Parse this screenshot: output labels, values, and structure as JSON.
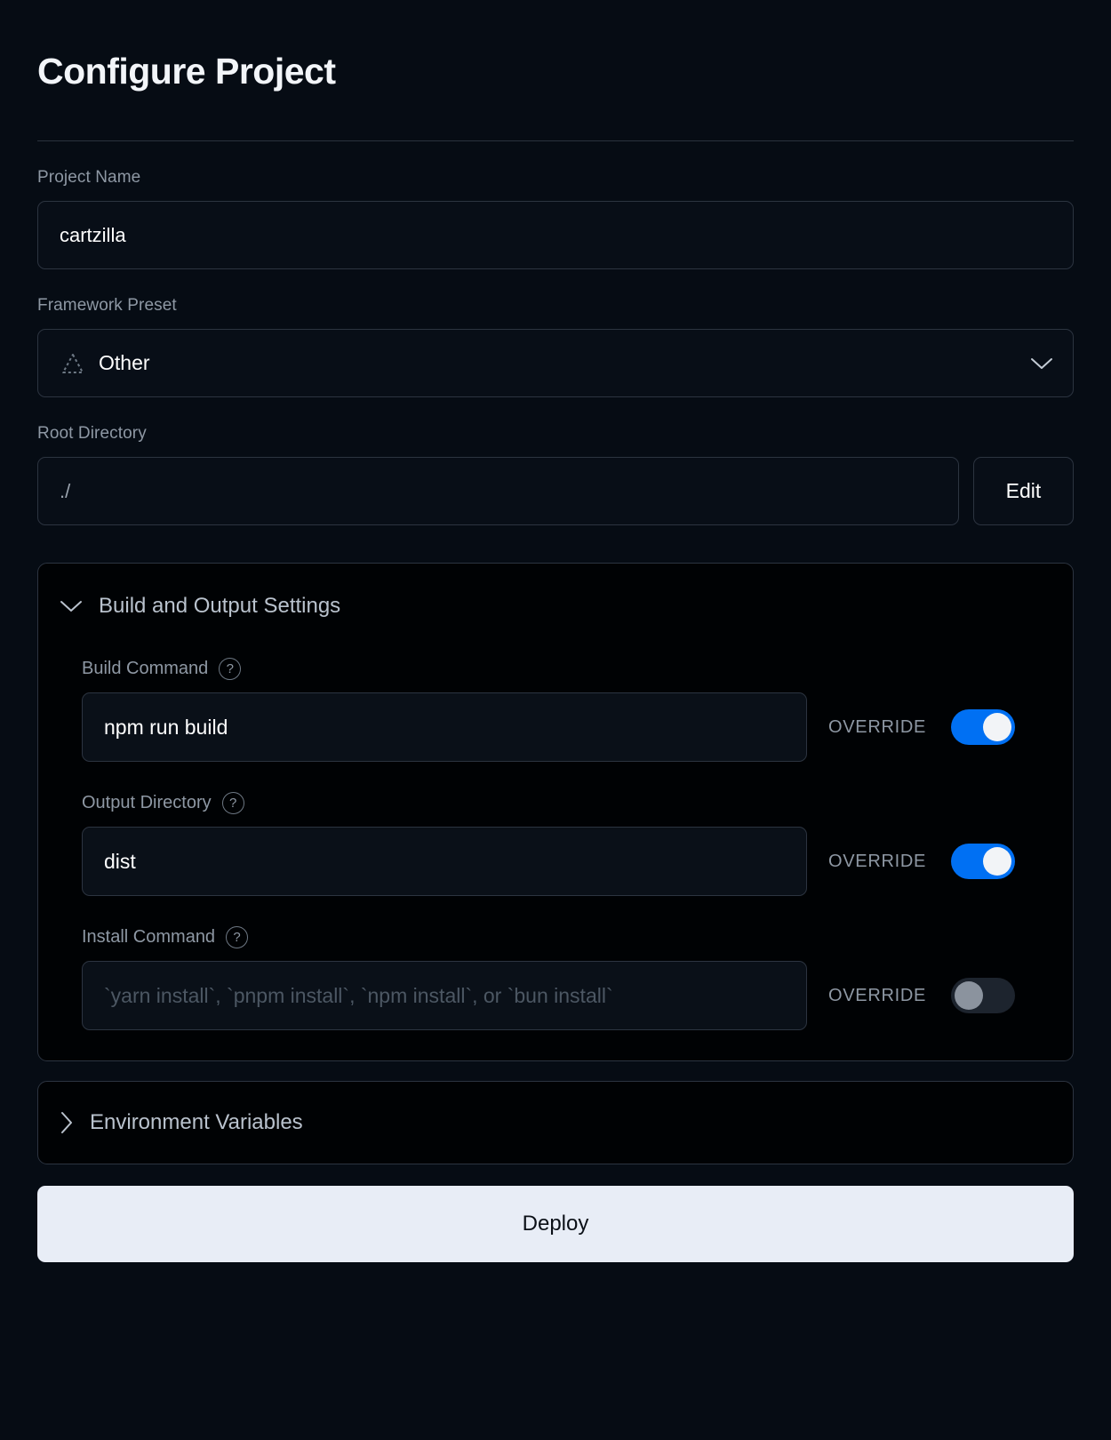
{
  "header": {
    "title": "Configure Project"
  },
  "project_name": {
    "label": "Project Name",
    "value": "cartzilla"
  },
  "framework_preset": {
    "label": "Framework Preset",
    "value": "Other",
    "icon": "dashed-triangle-icon",
    "chevron": "chevron-down-icon"
  },
  "root_directory": {
    "label": "Root Directory",
    "value": "./",
    "edit_label": "Edit"
  },
  "build_settings": {
    "title": "Build and Output Settings",
    "chevron": "chevron-down-icon",
    "help_glyph": "?",
    "override_label": "OVERRIDE",
    "fields": [
      {
        "label": "Build Command",
        "value": "npm run build",
        "placeholder": "",
        "override_label": "OVERRIDE",
        "override_on": true
      },
      {
        "label": "Output Directory",
        "value": "dist",
        "placeholder": "",
        "override_label": "OVERRIDE",
        "override_on": true
      },
      {
        "label": "Install Command",
        "value": "",
        "placeholder": "`yarn install`, `pnpm install`, `npm install`, or `bun install`",
        "override_label": "OVERRIDE",
        "override_on": false
      }
    ]
  },
  "environment_variables": {
    "title": "Environment Variables",
    "chevron": "chevron-right-icon"
  },
  "deploy": {
    "label": "Deploy"
  },
  "colors": {
    "page_background": "#060c14",
    "panel_background": "#000204",
    "border": "#2c3440",
    "label_text": "#8e98a4",
    "value_text": "#ffffff",
    "toggle_on": "#0070f3",
    "toggle_off": "#1d242e",
    "deploy_background": "#e8edf6",
    "deploy_text": "#0b1017"
  }
}
